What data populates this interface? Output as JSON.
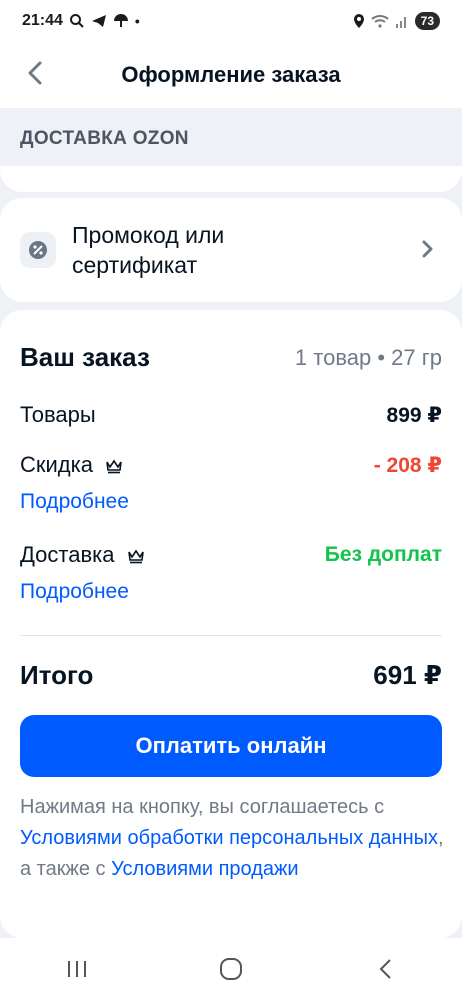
{
  "status_bar": {
    "time": "21:44",
    "battery": "73"
  },
  "header": {
    "title": "Оформление заказа"
  },
  "delivery_section": {
    "title": "ДОСТАВКА OZON"
  },
  "promo": {
    "label": "Промокод или сертификат"
  },
  "order": {
    "title": "Ваш заказ",
    "meta": "1 товар • 27 гр",
    "goods_label": "Товары",
    "goods_value": "899 ₽",
    "discount_label": "Скидка",
    "discount_value": "- 208 ₽",
    "discount_more": "Подробнее",
    "delivery_label": "Доставка",
    "delivery_value": "Без доплат",
    "delivery_more": "Подробнее",
    "total_label": "Итого",
    "total_value": "691 ₽",
    "pay_button": "Оплатить онлайн"
  },
  "legal": {
    "text1": "Нажимая на кнопку, вы соглашаетесь с ",
    "link1": "Условиями обработки персональных данных",
    "text2": ", а также с ",
    "link2": "Условиями продажи"
  },
  "colors": {
    "accent": "#005bff",
    "discount": "#f14635",
    "free": "#10c44c"
  }
}
